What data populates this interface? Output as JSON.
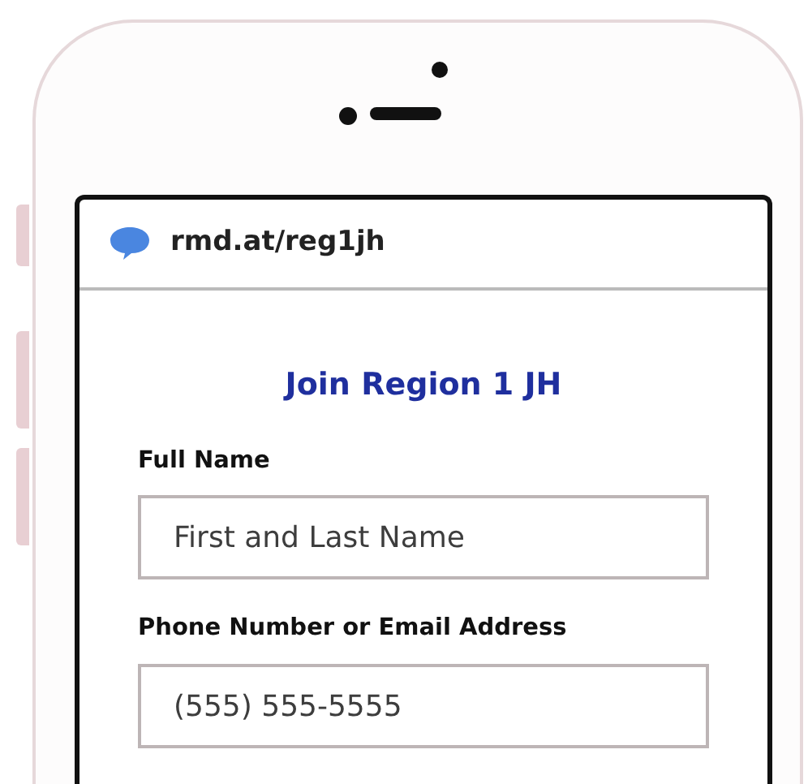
{
  "browser_bar": {
    "url": "rmd.at/reg1jh"
  },
  "form": {
    "title": "Join Region 1 JH",
    "fields": [
      {
        "label": "Full Name",
        "placeholder": "First and Last Name"
      },
      {
        "label": "Phone Number or Email Address",
        "placeholder": "(555) 555-5555"
      }
    ]
  }
}
